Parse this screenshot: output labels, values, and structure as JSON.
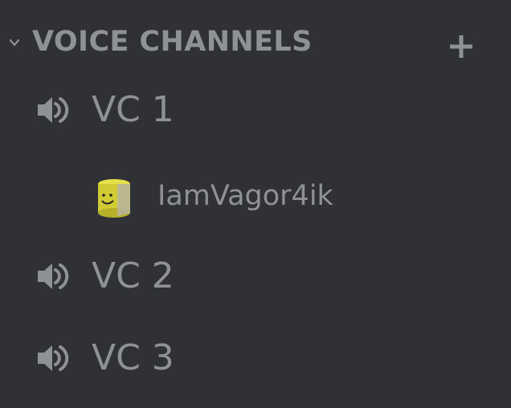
{
  "category": {
    "title": "VOICE CHANNELS",
    "collapse_icon": "chevron-down-icon",
    "add_icon": "plus-icon"
  },
  "channels": [
    {
      "name": "VC 1",
      "icon": "speaker-icon",
      "users": [
        {
          "username": "IamVagor4ik",
          "avatar_icon": "noob-head-avatar"
        }
      ]
    },
    {
      "name": "VC 2",
      "icon": "speaker-icon",
      "users": []
    },
    {
      "name": "VC 3",
      "icon": "speaker-icon",
      "users": []
    }
  ],
  "colors": {
    "background": "#2f3136",
    "text_muted": "#8e9297",
    "avatar_yellow": "#d8d23a"
  }
}
